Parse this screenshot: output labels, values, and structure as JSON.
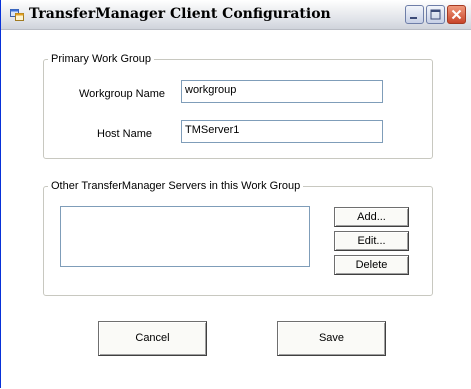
{
  "window": {
    "title": "TransferManager Client Configuration",
    "icons": {
      "app": "app-window-icon",
      "minimize": "minimize-icon",
      "maximize": "maximize-icon",
      "close": "close-icon"
    }
  },
  "primary_group": {
    "legend": "Primary Work Group",
    "workgroup_label": "Workgroup Name",
    "workgroup_value": "workgroup",
    "host_label": "Host Name",
    "host_value": "TMServer1"
  },
  "servers_group": {
    "legend": "Other TransferManager Servers in this Work Group",
    "items": [],
    "add_label": "Add...",
    "edit_label": "Edit...",
    "delete_label": "Delete"
  },
  "footer": {
    "cancel_label": "Cancel",
    "save_label": "Save"
  }
}
